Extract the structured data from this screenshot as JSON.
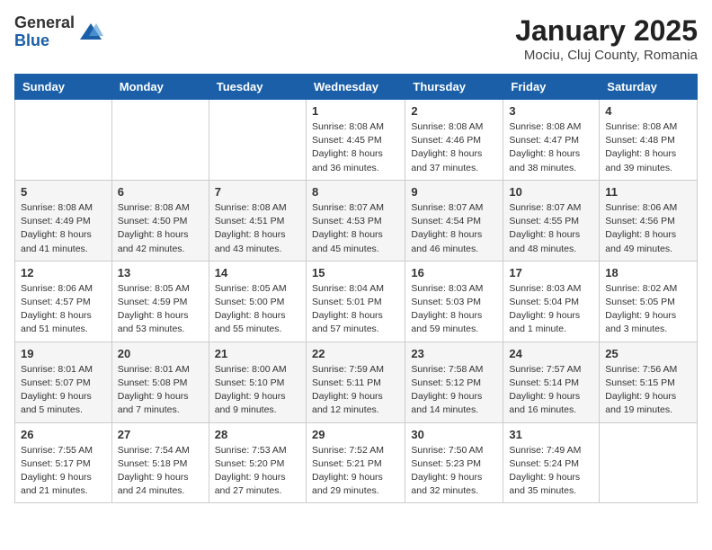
{
  "logo": {
    "general": "General",
    "blue": "Blue"
  },
  "title": "January 2025",
  "location": "Mociu, Cluj County, Romania",
  "weekdays": [
    "Sunday",
    "Monday",
    "Tuesday",
    "Wednesday",
    "Thursday",
    "Friday",
    "Saturday"
  ],
  "weeks": [
    [
      {
        "day": "",
        "info": ""
      },
      {
        "day": "",
        "info": ""
      },
      {
        "day": "",
        "info": ""
      },
      {
        "day": "1",
        "info": "Sunrise: 8:08 AM\nSunset: 4:45 PM\nDaylight: 8 hours and 36 minutes."
      },
      {
        "day": "2",
        "info": "Sunrise: 8:08 AM\nSunset: 4:46 PM\nDaylight: 8 hours and 37 minutes."
      },
      {
        "day": "3",
        "info": "Sunrise: 8:08 AM\nSunset: 4:47 PM\nDaylight: 8 hours and 38 minutes."
      },
      {
        "day": "4",
        "info": "Sunrise: 8:08 AM\nSunset: 4:48 PM\nDaylight: 8 hours and 39 minutes."
      }
    ],
    [
      {
        "day": "5",
        "info": "Sunrise: 8:08 AM\nSunset: 4:49 PM\nDaylight: 8 hours and 41 minutes."
      },
      {
        "day": "6",
        "info": "Sunrise: 8:08 AM\nSunset: 4:50 PM\nDaylight: 8 hours and 42 minutes."
      },
      {
        "day": "7",
        "info": "Sunrise: 8:08 AM\nSunset: 4:51 PM\nDaylight: 8 hours and 43 minutes."
      },
      {
        "day": "8",
        "info": "Sunrise: 8:07 AM\nSunset: 4:53 PM\nDaylight: 8 hours and 45 minutes."
      },
      {
        "day": "9",
        "info": "Sunrise: 8:07 AM\nSunset: 4:54 PM\nDaylight: 8 hours and 46 minutes."
      },
      {
        "day": "10",
        "info": "Sunrise: 8:07 AM\nSunset: 4:55 PM\nDaylight: 8 hours and 48 minutes."
      },
      {
        "day": "11",
        "info": "Sunrise: 8:06 AM\nSunset: 4:56 PM\nDaylight: 8 hours and 49 minutes."
      }
    ],
    [
      {
        "day": "12",
        "info": "Sunrise: 8:06 AM\nSunset: 4:57 PM\nDaylight: 8 hours and 51 minutes."
      },
      {
        "day": "13",
        "info": "Sunrise: 8:05 AM\nSunset: 4:59 PM\nDaylight: 8 hours and 53 minutes."
      },
      {
        "day": "14",
        "info": "Sunrise: 8:05 AM\nSunset: 5:00 PM\nDaylight: 8 hours and 55 minutes."
      },
      {
        "day": "15",
        "info": "Sunrise: 8:04 AM\nSunset: 5:01 PM\nDaylight: 8 hours and 57 minutes."
      },
      {
        "day": "16",
        "info": "Sunrise: 8:03 AM\nSunset: 5:03 PM\nDaylight: 8 hours and 59 minutes."
      },
      {
        "day": "17",
        "info": "Sunrise: 8:03 AM\nSunset: 5:04 PM\nDaylight: 9 hours and 1 minute."
      },
      {
        "day": "18",
        "info": "Sunrise: 8:02 AM\nSunset: 5:05 PM\nDaylight: 9 hours and 3 minutes."
      }
    ],
    [
      {
        "day": "19",
        "info": "Sunrise: 8:01 AM\nSunset: 5:07 PM\nDaylight: 9 hours and 5 minutes."
      },
      {
        "day": "20",
        "info": "Sunrise: 8:01 AM\nSunset: 5:08 PM\nDaylight: 9 hours and 7 minutes."
      },
      {
        "day": "21",
        "info": "Sunrise: 8:00 AM\nSunset: 5:10 PM\nDaylight: 9 hours and 9 minutes."
      },
      {
        "day": "22",
        "info": "Sunrise: 7:59 AM\nSunset: 5:11 PM\nDaylight: 9 hours and 12 minutes."
      },
      {
        "day": "23",
        "info": "Sunrise: 7:58 AM\nSunset: 5:12 PM\nDaylight: 9 hours and 14 minutes."
      },
      {
        "day": "24",
        "info": "Sunrise: 7:57 AM\nSunset: 5:14 PM\nDaylight: 9 hours and 16 minutes."
      },
      {
        "day": "25",
        "info": "Sunrise: 7:56 AM\nSunset: 5:15 PM\nDaylight: 9 hours and 19 minutes."
      }
    ],
    [
      {
        "day": "26",
        "info": "Sunrise: 7:55 AM\nSunset: 5:17 PM\nDaylight: 9 hours and 21 minutes."
      },
      {
        "day": "27",
        "info": "Sunrise: 7:54 AM\nSunset: 5:18 PM\nDaylight: 9 hours and 24 minutes."
      },
      {
        "day": "28",
        "info": "Sunrise: 7:53 AM\nSunset: 5:20 PM\nDaylight: 9 hours and 27 minutes."
      },
      {
        "day": "29",
        "info": "Sunrise: 7:52 AM\nSunset: 5:21 PM\nDaylight: 9 hours and 29 minutes."
      },
      {
        "day": "30",
        "info": "Sunrise: 7:50 AM\nSunset: 5:23 PM\nDaylight: 9 hours and 32 minutes."
      },
      {
        "day": "31",
        "info": "Sunrise: 7:49 AM\nSunset: 5:24 PM\nDaylight: 9 hours and 35 minutes."
      },
      {
        "day": "",
        "info": ""
      }
    ]
  ]
}
